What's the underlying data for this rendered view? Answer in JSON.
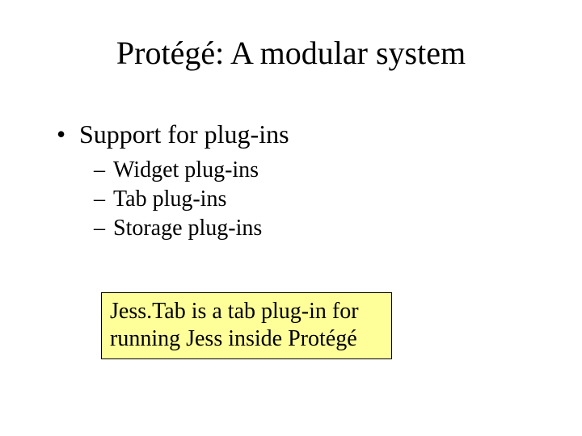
{
  "title": "Protégé: A modular system",
  "body": {
    "level1": {
      "bullet": "•",
      "text": "Support for plug-ins"
    },
    "level2": [
      {
        "dash": "–",
        "text": "Widget plug-ins"
      },
      {
        "dash": "–",
        "text": "Tab plug-ins"
      },
      {
        "dash": "–",
        "text": "Storage plug-ins"
      }
    ]
  },
  "callout": "Jess.Tab is a tab plug-in for running Jess inside Protégé"
}
